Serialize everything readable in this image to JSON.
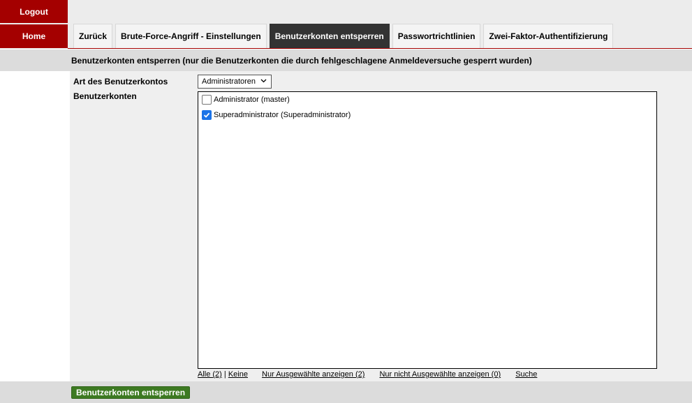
{
  "sidebar": {
    "logout_label": "Logout",
    "home_label": "Home"
  },
  "tabs": [
    {
      "label": "Zurück",
      "active": false
    },
    {
      "label": "Brute-Force-Angriff - Einstellungen",
      "active": false
    },
    {
      "label": "Benutzerkonten entsperren",
      "active": true
    },
    {
      "label": "Passwortrichtlinien",
      "active": false
    },
    {
      "label": "Zwei-Faktor-Authentifizierung",
      "active": false
    }
  ],
  "section": {
    "title": "Benutzerkonten entsperren (nur die Benutzerkonten die durch fehlgeschlagene Anmeldeversuche gesperrt wurden)"
  },
  "form": {
    "account_type_label": "Art des Benutzerkontos",
    "account_type_value": "Administratoren",
    "accounts_label": "Benutzerkonten",
    "accounts": [
      {
        "label": "Administrator (master)",
        "checked": false
      },
      {
        "label": "Superadministrator (Superadministrator)",
        "checked": true
      }
    ]
  },
  "list_links": {
    "all": "Alle (2)",
    "separator": "|",
    "none": "Keine",
    "only_selected": "Nur Ausgewählte anzeigen (2)",
    "only_unselected": "Nur nicht Ausgewählte anzeigen (0)",
    "search": "Suche"
  },
  "footer": {
    "submit_label": "Benutzerkonten entsperren"
  },
  "colors": {
    "brand_red": "#a40000",
    "active_tab": "#333333",
    "submit_green": "#3d7a22",
    "checkbox_blue": "#1a73e8"
  }
}
